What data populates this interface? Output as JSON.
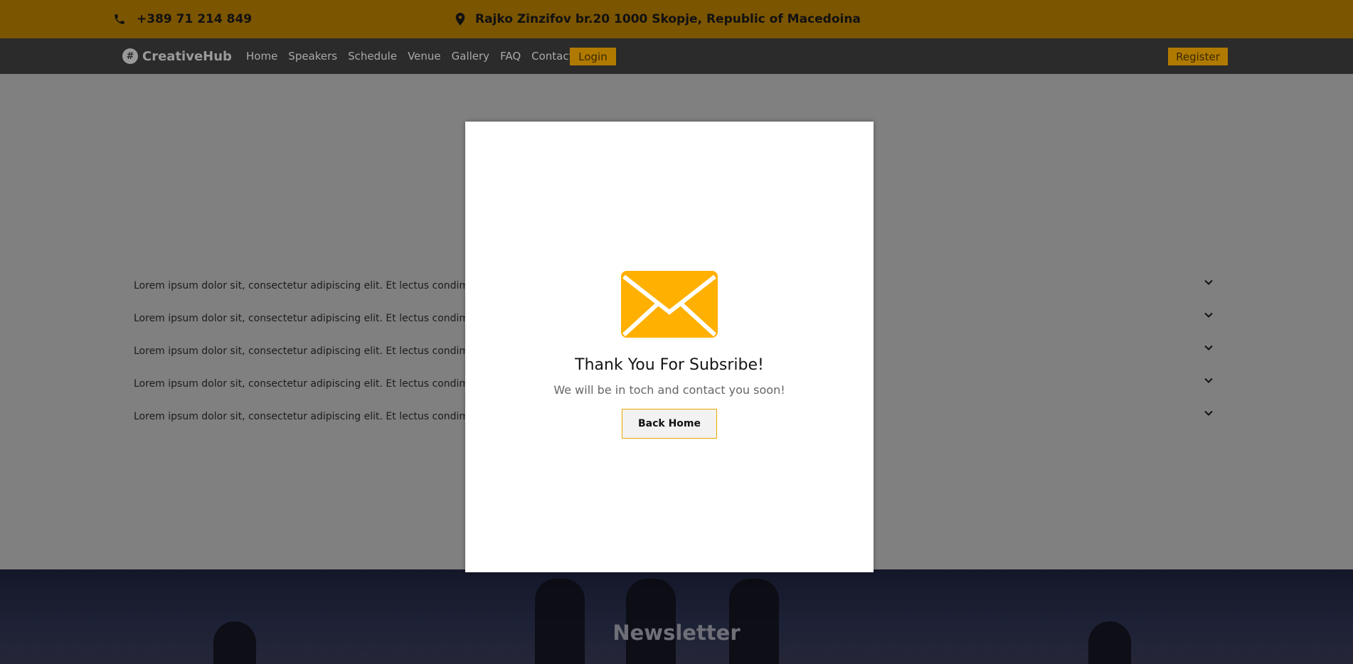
{
  "topbar": {
    "phone": "+389 71 214 849",
    "address": "Rajko Zinzifov br.20 1000 Skopje, Republic of Macedoina"
  },
  "nav": {
    "logo": "CreativeHub",
    "items": [
      "Home",
      "Speakers",
      "Schedule",
      "Venue",
      "Gallery",
      "FAQ",
      "Contact"
    ],
    "login": "Login",
    "register": "Register"
  },
  "faq": {
    "items": [
      "Lorem ipsum dolor sit, consectetur adipiscing elit. Et lectus condimentum",
      "Lorem ipsum dolor sit, consectetur adipiscing elit. Et lectus condimentum",
      "Lorem ipsum dolor sit, consectetur adipiscing elit. Et lectus condimentum",
      "Lorem ipsum dolor sit, consectetur adipiscing elit. Et lectus condimentum",
      "Lorem ipsum dolor sit, consectetur adipiscing elit. Et lectus condimentum"
    ]
  },
  "newsletter": {
    "title": "Newsletter"
  },
  "modal": {
    "title": "Thank You For Subsribe!",
    "message": "We will be in toch and contact you soon!",
    "button": "Back Home"
  },
  "colors": {
    "accent": "#ffb000",
    "topbar": "#7b5500",
    "navbar": "#2b2b2b"
  },
  "icons": {
    "phone": "phone-icon",
    "address": "map-pin-icon",
    "envelope": "envelope-icon",
    "chevron": "chevron-down-icon"
  }
}
